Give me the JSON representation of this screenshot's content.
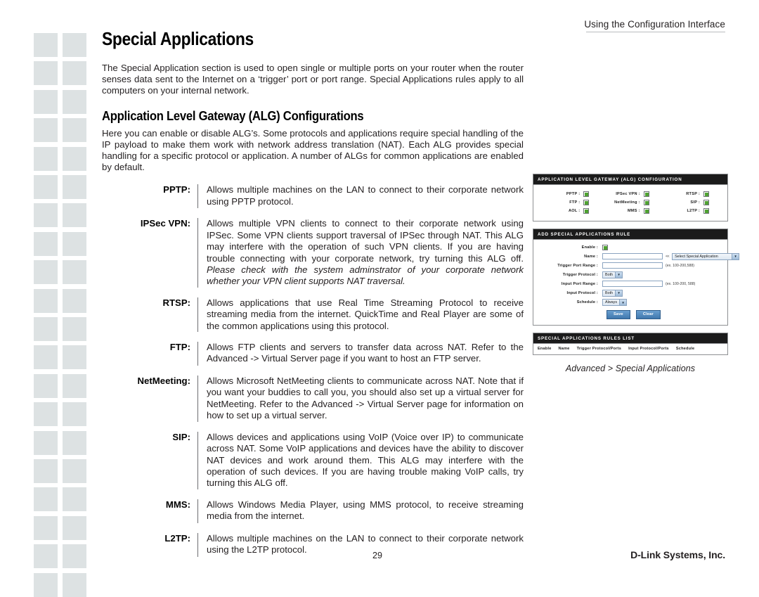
{
  "header": {
    "running_head": "Using the Configuration Interface"
  },
  "page": {
    "title": "Special Applications",
    "intro": "The Special Application section is used to open single or multiple ports on your router when the router senses data sent to the Internet on a ‘trigger’ port or port range. Special Applications rules apply to all computers on your internal network.",
    "section_title": "Application Level Gateway (ALG) Configurations",
    "section_intro": "Here you can enable or disable ALG’s. Some protocols and applications require special handling of the IP payload to make them work with network address translation (NAT). Each ALG provides special handling for a specific protocol or application. A number of ALGs for common applications are enabled by default."
  },
  "definitions": [
    {
      "term": "PPTP:",
      "text": "Allows multiple machines on the LAN to connect to their corporate network using PPTP protocol.",
      "italic_text": ""
    },
    {
      "term": "IPSec VPN:",
      "text": "Allows multiple VPN clients to connect to their corporate network using IPSec. Some VPN clients support traversal of IPSec through NAT. This ALG may interfere with the operation of such VPN clients. If you are having trouble connecting with your corporate network, try turning this ALG off. ",
      "italic_text": "Please check with the system adminstrator of your corporate network whether your VPN client supports NAT traversal."
    },
    {
      "term": "RTSP:",
      "text": "Allows applications that use Real Time Streaming Protocol to receive streaming media from the internet. QuickTime and Real Player are some of the common applications using this protocol.",
      "italic_text": ""
    },
    {
      "term": "FTP:",
      "text": "Allows FTP clients and servers to transfer data across NAT. Refer to the Advanced -> Virtual Server page if you want to host an FTP server.",
      "italic_text": ""
    },
    {
      "term": "NetMeeting:",
      "text": "Allows Microsoft NetMeeting clients to communicate across NAT. Note that if you want your buddies to call you, you should also set up a virtual server for NetMeeting. Refer to the Advanced -> Virtual Server page for information on how to set up a virtual server.",
      "italic_text": ""
    },
    {
      "term": "SIP:",
      "text": "Allows devices and applications using VoIP (Voice over IP) to communicate across NAT. Some VoIP applications and devices have the ability to discover NAT devices and work around them. This ALG may interfere with the operation of such devices. If you are having trouble making VoIP calls, try turning this ALG off.",
      "italic_text": ""
    },
    {
      "term": "MMS:",
      "text": "Allows Windows Media Player, using MMS protocol, to receive streaming media from the internet.",
      "italic_text": ""
    },
    {
      "term": "L2TP:",
      "text": "Allows multiple machines on the LAN to connect to their corporate network using the L2TP protocol.",
      "italic_text": ""
    }
  ],
  "figure": {
    "alg_panel": {
      "title": "APPLICATION LEVEL GATEWAY (ALG) CONFIGURATION",
      "checkboxes": [
        {
          "label": "PPTP :",
          "checked": true
        },
        {
          "label": "IPSec VPN :",
          "checked": true
        },
        {
          "label": "RTSP :",
          "checked": true
        },
        {
          "label": "FTP :",
          "checked": true
        },
        {
          "label": "NetMeeting :",
          "checked": true
        },
        {
          "label": "SIP :",
          "checked": true
        },
        {
          "label": "AOL :",
          "checked": true
        },
        {
          "label": "MMS :",
          "checked": true
        },
        {
          "label": "L2TP :",
          "checked": true
        }
      ]
    },
    "add_rule_panel": {
      "title": "ADD SPECIAL APPLICATIONS RULE",
      "enable_label": "Enable :",
      "enable_checked": true,
      "name_label": "Name :",
      "name_value": "",
      "name_arrows": "<<",
      "name_select_value": "Select Special Application",
      "trigger_port_label": "Trigger Port Range :",
      "trigger_port_value": "",
      "trigger_port_hint": "(ex. 100-200,588)",
      "trigger_protocol_label": "Trigger Protocol :",
      "trigger_protocol_value": "Both",
      "input_port_label": "Input Port Range :",
      "input_port_value": "",
      "input_port_hint": "(ex. 100-200, 588)",
      "input_protocol_label": "Input Protocol :",
      "input_protocol_value": "Both",
      "schedule_label": "Schedule :",
      "schedule_value": "Always",
      "save_label": "Save",
      "clear_label": "Clear"
    },
    "rules_list_panel": {
      "title": "SPECIAL APPLICATIONS RULES LIST",
      "columns": [
        "Enable",
        "Name",
        "Trigger Protocol/Ports",
        "Input Protocol/Ports",
        "Schedule"
      ]
    },
    "caption": "Advanced > Special Applications"
  },
  "footer": {
    "page_number": "29",
    "company": "D-Link Systems, Inc."
  },
  "colors": {
    "panel_header_bg": "#1b1b1b",
    "checkbox_check": "#4fa331",
    "button_blue": "#3f77ad",
    "deco_square": "#dde2e3"
  }
}
